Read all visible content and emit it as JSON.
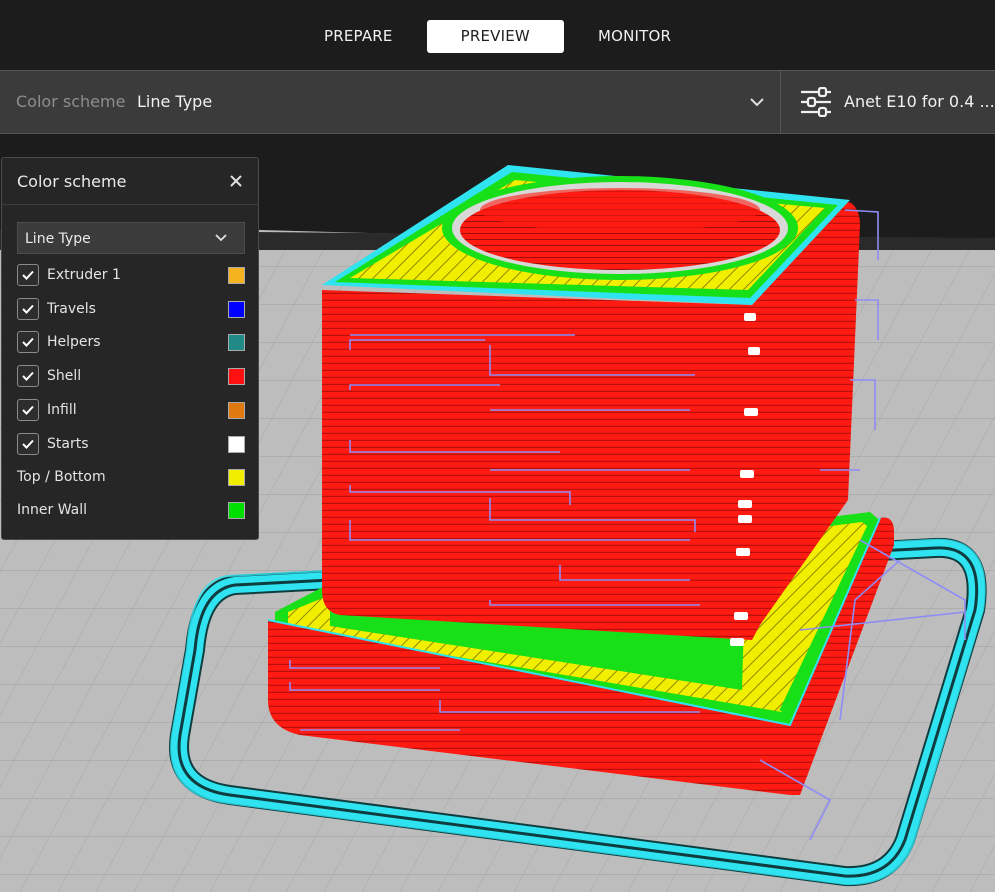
{
  "stages": [
    {
      "label": "PREPARE",
      "active": false
    },
    {
      "label": "PREVIEW",
      "active": true
    },
    {
      "label": "MONITOR",
      "active": false
    }
  ],
  "toolbar": {
    "scheme_label": "Color scheme",
    "scheme_value": "Line Type",
    "printer_name": "Anet E10 for 0.4 ...) -"
  },
  "panel": {
    "title": "Color scheme",
    "dropdown_value": "Line Type",
    "items": [
      {
        "label": "Extruder 1",
        "checked": true,
        "color": "#f5b31f"
      },
      {
        "label": "Travels",
        "checked": true,
        "color": "#0000ff"
      },
      {
        "label": "Helpers",
        "checked": true,
        "color": "#1f8a86"
      },
      {
        "label": "Shell",
        "checked": true,
        "color": "#ff1010"
      },
      {
        "label": "Infill",
        "checked": true,
        "color": "#e07a10"
      },
      {
        "label": "Starts",
        "checked": true,
        "color": "#ffffff"
      },
      {
        "label": "Top / Bottom",
        "checked": null,
        "color": "#f2ee00"
      },
      {
        "label": "Inner Wall",
        "checked": null,
        "color": "#00e000"
      }
    ]
  },
  "colors": {
    "accent_cyan": "#2fe3f0",
    "shell_red": "#ff1a12",
    "top_yellow": "#f2ee00",
    "inner_green": "#18e018",
    "travel_blue": "#8f8cf5",
    "bed": "#b9b9b9"
  }
}
